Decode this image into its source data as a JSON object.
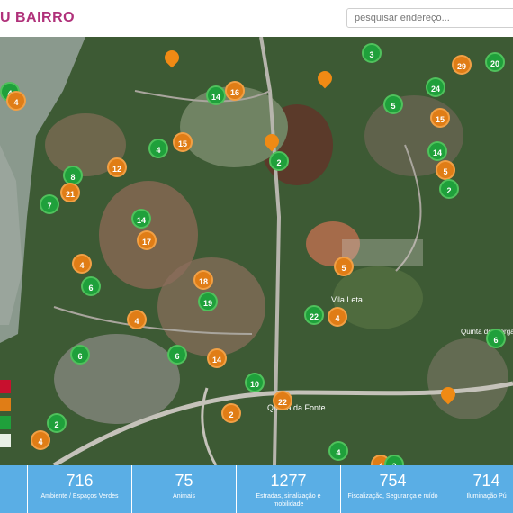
{
  "header": {
    "brand": "U BAIRRO",
    "search_placeholder": "pesquisar endereço..."
  },
  "map": {
    "place_labels": [
      "Quinta da Fonte",
      "Vila Leta",
      "Quinta do Morgado"
    ],
    "clusters": [
      {
        "n": "3",
        "c": "g"
      },
      {
        "n": "29",
        "c": "o"
      },
      {
        "n": "20",
        "c": "g"
      },
      {
        "n": "4",
        "c": "g"
      },
      {
        "n": "14",
        "c": "g"
      },
      {
        "n": "16",
        "c": "o"
      },
      {
        "n": "24",
        "c": "g"
      },
      {
        "n": "15",
        "c": "o"
      },
      {
        "n": "4",
        "c": "o"
      },
      {
        "n": "5",
        "c": "g"
      },
      {
        "n": "4",
        "c": "g"
      },
      {
        "n": "15",
        "c": "o"
      },
      {
        "n": "14",
        "c": "g"
      },
      {
        "n": "8",
        "c": "g"
      },
      {
        "n": "12",
        "c": "o"
      },
      {
        "n": "2",
        "c": "g"
      },
      {
        "n": "5",
        "c": "o"
      },
      {
        "n": "21",
        "c": "o"
      },
      {
        "n": "2",
        "c": "g"
      },
      {
        "n": "7",
        "c": "g"
      },
      {
        "n": "14",
        "c": "g"
      },
      {
        "n": "17",
        "c": "o"
      },
      {
        "n": "4",
        "c": "o"
      },
      {
        "n": "5",
        "c": "o"
      },
      {
        "n": "6",
        "c": "g"
      },
      {
        "n": "18",
        "c": "o"
      },
      {
        "n": "19",
        "c": "g"
      },
      {
        "n": "4",
        "c": "o"
      },
      {
        "n": "22",
        "c": "g"
      },
      {
        "n": "4",
        "c": "o"
      },
      {
        "n": "6",
        "c": "g"
      },
      {
        "n": "6",
        "c": "g"
      },
      {
        "n": "14",
        "c": "o"
      },
      {
        "n": "10",
        "c": "g"
      },
      {
        "n": "22",
        "c": "o"
      },
      {
        "n": "2",
        "c": "g"
      },
      {
        "n": "2",
        "c": "o"
      },
      {
        "n": "4",
        "c": "o"
      },
      {
        "n": "4",
        "c": "g"
      },
      {
        "n": "6",
        "c": "g"
      },
      {
        "n": "4",
        "c": "o"
      },
      {
        "n": "2",
        "c": "g"
      }
    ]
  },
  "legend_colors": [
    "#c8102e",
    "#e07d16",
    "#1fa03b",
    "#e9f0e6"
  ],
  "stats": [
    {
      "value": "",
      "label": ""
    },
    {
      "value": "716",
      "label": "Ambiente / Espaços Verdes"
    },
    {
      "value": "75",
      "label": "Animais"
    },
    {
      "value": "1277",
      "label": "Estradas, sinalização e mobilidade"
    },
    {
      "value": "754",
      "label": "Fiscalização, Segurança e ruído"
    },
    {
      "value": "714",
      "label": "Iluminação Pú"
    }
  ]
}
